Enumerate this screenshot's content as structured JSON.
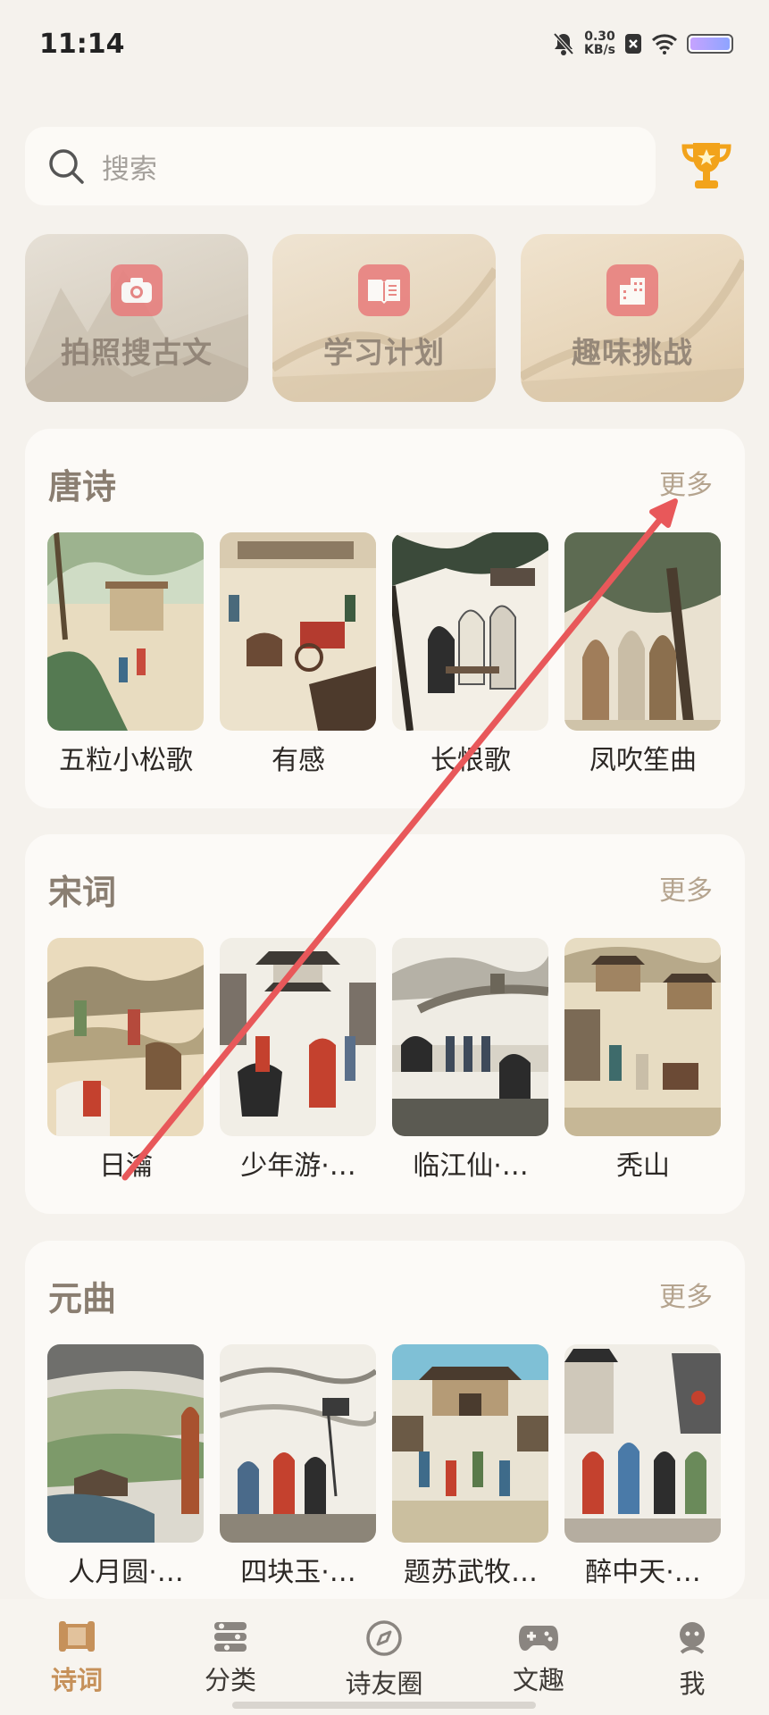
{
  "status_bar": {
    "time": "11:14",
    "net_speed_value": "0.30",
    "net_speed_unit": "KB/s"
  },
  "search": {
    "placeholder": "搜索"
  },
  "quick_actions": [
    {
      "label": "拍照搜古文",
      "icon": "camera-icon"
    },
    {
      "label": "学习计划",
      "icon": "book-icon"
    },
    {
      "label": "趣味挑战",
      "icon": "building-icon"
    }
  ],
  "sections": [
    {
      "title": "唐诗",
      "more": "更多",
      "items": [
        "五粒小松歌",
        "有感",
        "长恨歌",
        "凤吹笙曲"
      ]
    },
    {
      "title": "宋词",
      "more": "更多",
      "items": [
        "日瀹",
        "少年游·…",
        "临江仙·…",
        "秃山"
      ]
    },
    {
      "title": "元曲",
      "more": "更多",
      "items": [
        "人月圆·…",
        "四块玉·…",
        "题苏武牧…",
        "醉中天·…"
      ]
    }
  ],
  "tab_bar": [
    {
      "label": "诗词",
      "icon": "scroll-icon",
      "active": true
    },
    {
      "label": "分类",
      "icon": "category-icon",
      "active": false
    },
    {
      "label": "诗友圈",
      "icon": "compass-icon",
      "active": false
    },
    {
      "label": "文趣",
      "icon": "gamepad-icon",
      "active": false
    },
    {
      "label": "我",
      "icon": "profile-icon",
      "active": false
    }
  ],
  "colors": {
    "accent": "#c6915a",
    "background": "#f5f2ed",
    "annotation_arrow": "#e8585a"
  }
}
